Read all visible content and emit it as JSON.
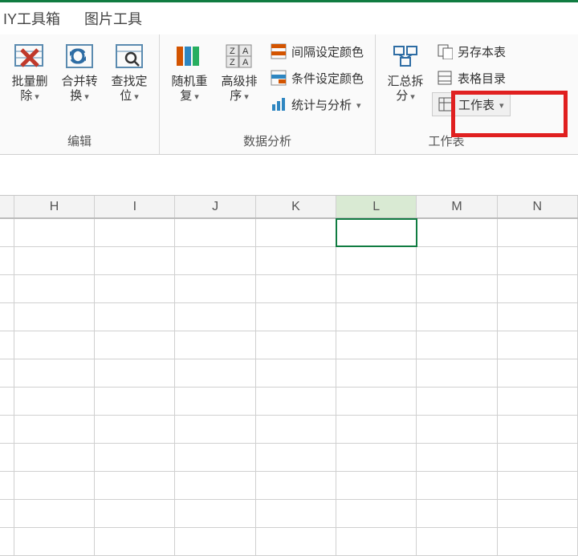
{
  "tabs": {
    "t1": "IY工具箱",
    "t2": "图片工具"
  },
  "groups": {
    "edit": {
      "label": "编辑",
      "batchDelete": "批量删\n除",
      "mergeConvert": "合并转\n换",
      "findLocate": "查找定\n位"
    },
    "dataAnalysis": {
      "label": "数据分析",
      "randomRepeat": "随机重\n复",
      "advancedSort": "高级排\n序",
      "intervalColor": "间隔设定颜色",
      "conditionColor": "条件设定颜色",
      "statsAnalysis": "统计与分析"
    },
    "worksheet": {
      "label": "工作表",
      "summarySplit": "汇总拆\n分",
      "saveSheet": "另存本表",
      "toc": "表格目录",
      "worksheetBtn": "工作表"
    }
  },
  "columns": [
    "",
    "H",
    "I",
    "J",
    "K",
    "L",
    "M",
    "N"
  ],
  "selectedColumn": "L"
}
